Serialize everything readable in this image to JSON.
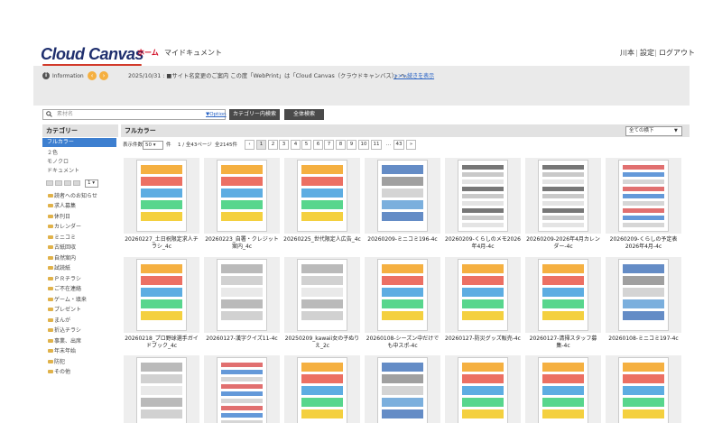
{
  "header": {
    "logo_text": "Cloud Canvas",
    "nav_home": "ホーム",
    "nav_mycontent": "マイドキュメント",
    "user_name": "川本",
    "settings": "設定",
    "logout": "ログアウト"
  },
  "info": {
    "label": "Information",
    "news_text": "2025/10/31 : ■サイト名変更のご案内 この度「WebPrint」は「Cloud Canvas（クラウドキャンバス）」へ…",
    "more_link": ">>>続きを表示"
  },
  "search": {
    "placeholder": "素材名",
    "option_link": "▼Option",
    "category_search_label": "カテゴリー内検索",
    "all_search_label": "全体検索"
  },
  "sidebar": {
    "heading": "カテゴリー",
    "selected": "フルカラー",
    "items": [
      "２色",
      "モノクロ",
      "ドキュメント"
    ],
    "per_page_value": "1",
    "folders": [
      "読者へのお知らせ",
      "求人募集",
      "休刊日",
      "カレンダー",
      "ミニコミ",
      "古紙回収",
      "自然案内",
      "試読紙",
      "ＰＲチラシ",
      "ご不在連絡",
      "ゲーム・填来",
      "プレゼント",
      "まんが",
      "折込チラシ",
      "事業、出席",
      "年末年始",
      "防犯",
      "その他"
    ]
  },
  "main": {
    "title": "フルカラー",
    "sort_selected": "全ての横下",
    "display_count_label": "表示件数:",
    "per_page": "50",
    "per_page_unit": "件",
    "page_info": "1 / 全43ページ",
    "total": "全2145件",
    "pages": [
      "‹",
      "1",
      "2",
      "3",
      "4",
      "5",
      "6",
      "7",
      "8",
      "9",
      "10",
      "11",
      "…",
      "43",
      "»"
    ],
    "current_page": "1"
  },
  "thumbnails_row1": [
    {
      "caption": "20260227_土日祝限定求人チラシ_4c",
      "style": "colorful"
    },
    {
      "caption": "20260223_自署・クレジット案内_4c",
      "style": "colorful"
    },
    {
      "caption": "20260225_世代限定人広告_4c",
      "style": "colorful"
    },
    {
      "caption": "20260209-ミニコミ196-4c",
      "style": "layout"
    },
    {
      "caption": "20260209-くらしのメモ2026年4月-4c",
      "style": "calendar"
    },
    {
      "caption": "20260209-2026年4月カレンダー-4c",
      "style": "calendar"
    },
    {
      "caption": "20260209-くらしの予定表2026年4月-4c",
      "style": "table"
    }
  ],
  "thumbnails_row2": [
    {
      "caption": "20260218_プロ野球選手ガイドブック_4c",
      "style": "colorful"
    },
    {
      "caption": "20260127-漢字クイズ11-4c",
      "style": "mono"
    },
    {
      "caption": "20250209_kawaii女の子ぬりえ_2c",
      "style": "mono"
    },
    {
      "caption": "20260108-シーズン中だけでも中スポ-4c",
      "style": "colorful"
    },
    {
      "caption": "20260127-防災グッズ販売-4c",
      "style": "colorful"
    },
    {
      "caption": "20260127-清掃スタッフ募集-4c",
      "style": "colorful"
    },
    {
      "caption": "20260108-ミニコミ197-4c",
      "style": "layout"
    }
  ],
  "thumbnails_row3": [
    {
      "caption": "",
      "style": "mono"
    },
    {
      "caption": "",
      "style": "table"
    },
    {
      "caption": "",
      "style": "colorful"
    },
    {
      "caption": "",
      "style": "layout"
    },
    {
      "caption": "",
      "style": "colorful"
    },
    {
      "caption": "",
      "style": "colorful"
    },
    {
      "caption": "",
      "style": "colorful"
    }
  ],
  "colors": {
    "accent_red": "#d0021b",
    "brand_blue": "#1f2f6e",
    "selection_blue": "#3d7fd0",
    "link_blue": "#2a64c5",
    "info_orange": "#f5b041"
  }
}
